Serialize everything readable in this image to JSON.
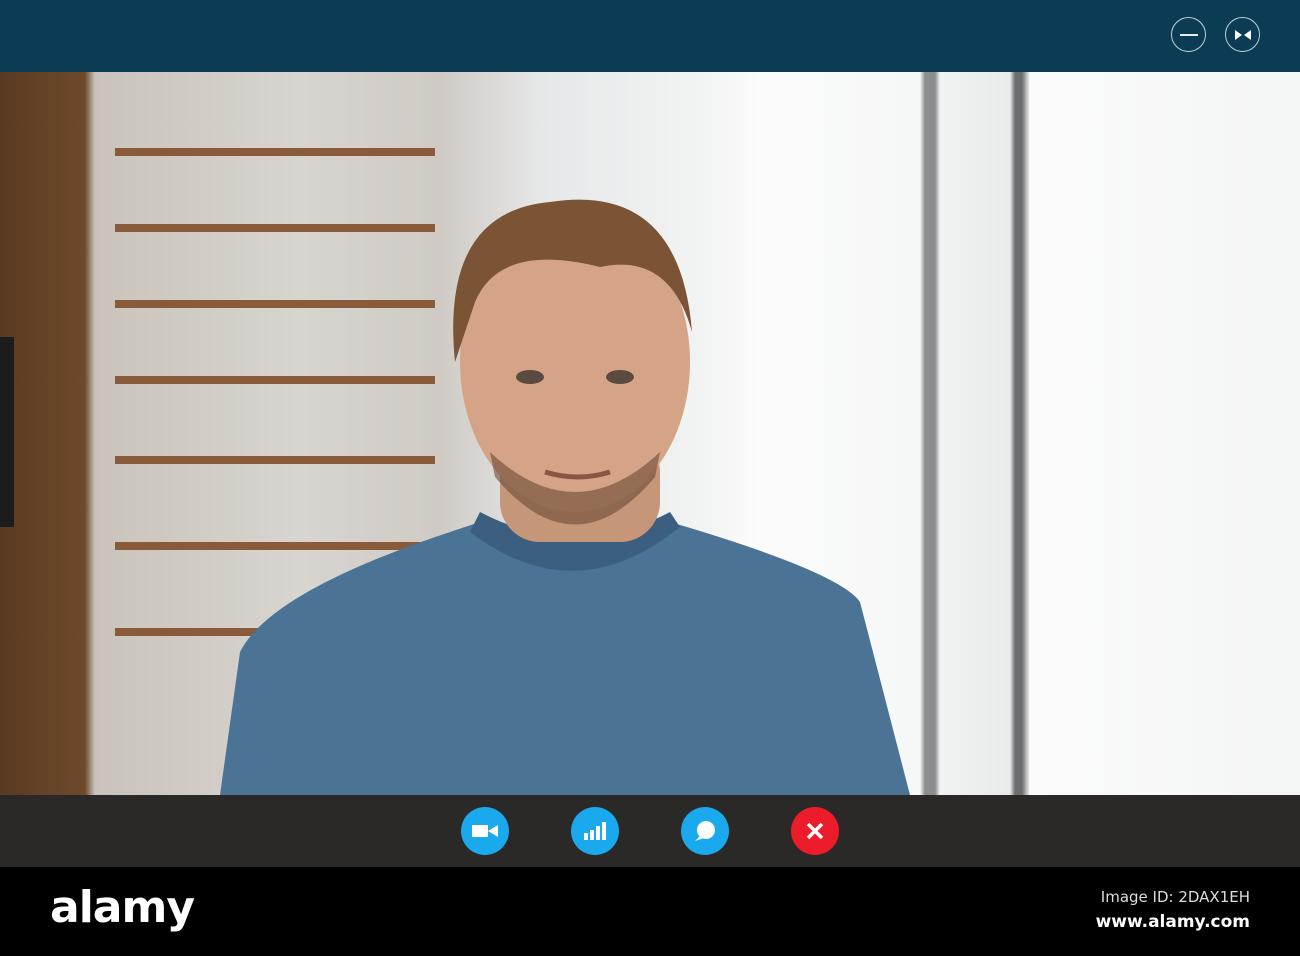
{
  "window": {
    "minimize_icon": "minimize-icon",
    "restore_icon": "collapse-icon"
  },
  "controls": [
    {
      "name": "video-camera-button",
      "icon": "video-camera-icon",
      "color": "#1aa9ec"
    },
    {
      "name": "signal-button",
      "icon": "signal-bars-icon",
      "color": "#1aa9ec"
    },
    {
      "name": "chat-button",
      "icon": "chat-bubble-icon",
      "color": "#1aa9ec"
    },
    {
      "name": "end-call-button",
      "icon": "close-icon",
      "color": "#ec1c2a"
    }
  ],
  "footer": {
    "logo": "alamy",
    "image_id": "Image ID: 2DAX1EH",
    "site": "www.alamy.com"
  }
}
